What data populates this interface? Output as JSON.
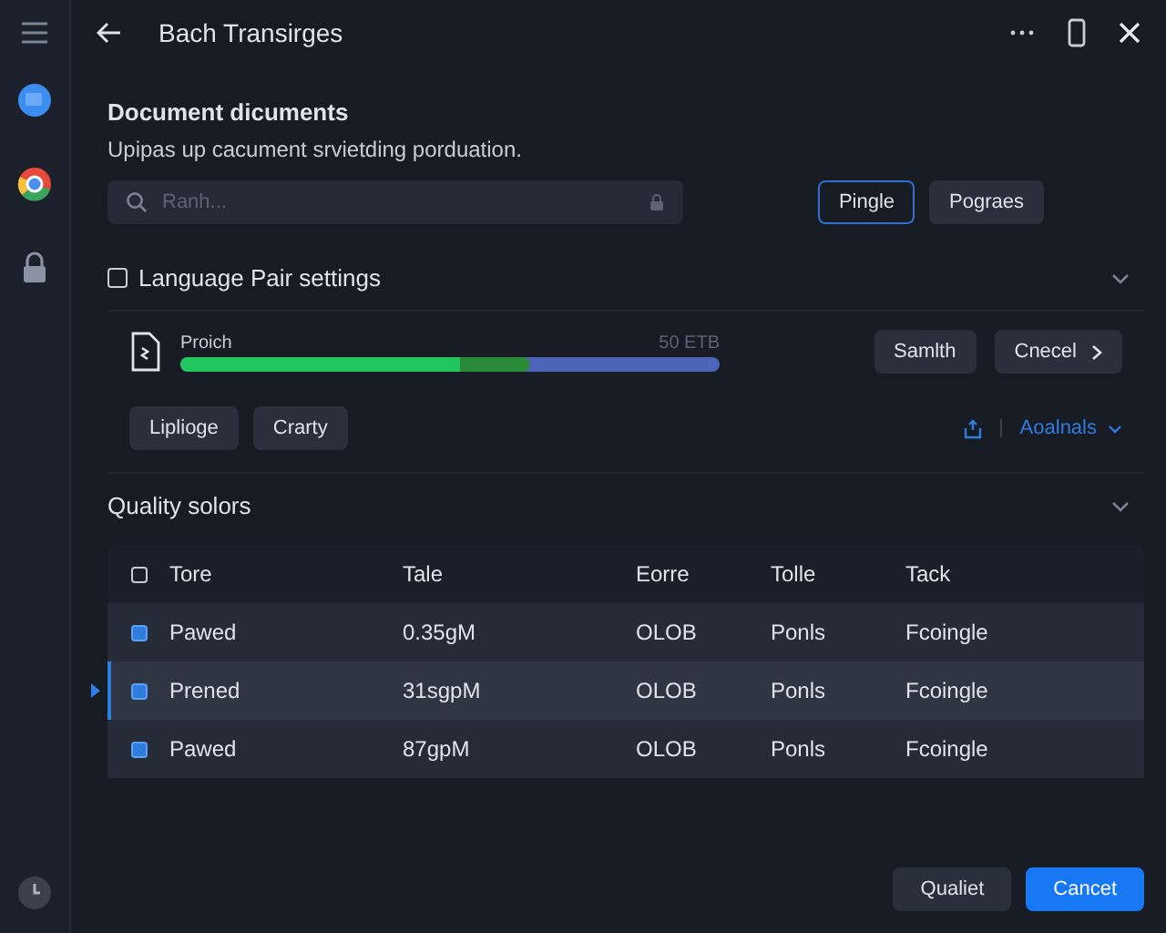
{
  "window": {
    "title": "Bach Transirges"
  },
  "sidebar": {
    "items": [
      {
        "kind": "chat"
      },
      {
        "kind": "browser"
      },
      {
        "kind": "lock"
      }
    ]
  },
  "header": {
    "title": "Document dicuments",
    "subtitle": "Upipas up cacument srvietding porduation."
  },
  "search": {
    "placeholder": "Ranh..."
  },
  "top_buttons": [
    {
      "label": "Pingle",
      "selected": true
    },
    {
      "label": "Pograes",
      "selected": false
    }
  ],
  "language_section": {
    "title": "Language Pair settings",
    "checked": false,
    "expanded": true,
    "progress": {
      "label": "Proich",
      "reading": "50 ETB",
      "level": 0.65
    },
    "actions": [
      {
        "label": "Samlth",
        "kind": "plain"
      },
      {
        "label": "Cnecel",
        "kind": "next"
      }
    ],
    "chips": [
      "Liplioge",
      "Crarty"
    ],
    "link": "Aoalnals"
  },
  "quality_section": {
    "title": "Quality solors",
    "expanded": true
  },
  "table": {
    "header_checked": false,
    "columns": [
      "Tore",
      "Tale",
      "Eorre",
      "Tolle",
      "Tack"
    ],
    "rows": [
      {
        "checked": true,
        "selected": false,
        "cells": [
          "Pawed",
          "0.35gM",
          "OLOB",
          "Ponls",
          "Fcoingle"
        ]
      },
      {
        "checked": true,
        "selected": true,
        "cells": [
          "Prened",
          "31sgpM",
          "OLOB",
          "Ponls",
          "Fcoingle"
        ]
      },
      {
        "checked": true,
        "selected": false,
        "cells": [
          "Pawed",
          "87gpM",
          "OLOB",
          "Ponls",
          "Fcoingle"
        ]
      }
    ]
  },
  "footer_buttons": [
    {
      "label": "Qualiet",
      "primary": false
    },
    {
      "label": "Cancet",
      "primary": true
    }
  ]
}
